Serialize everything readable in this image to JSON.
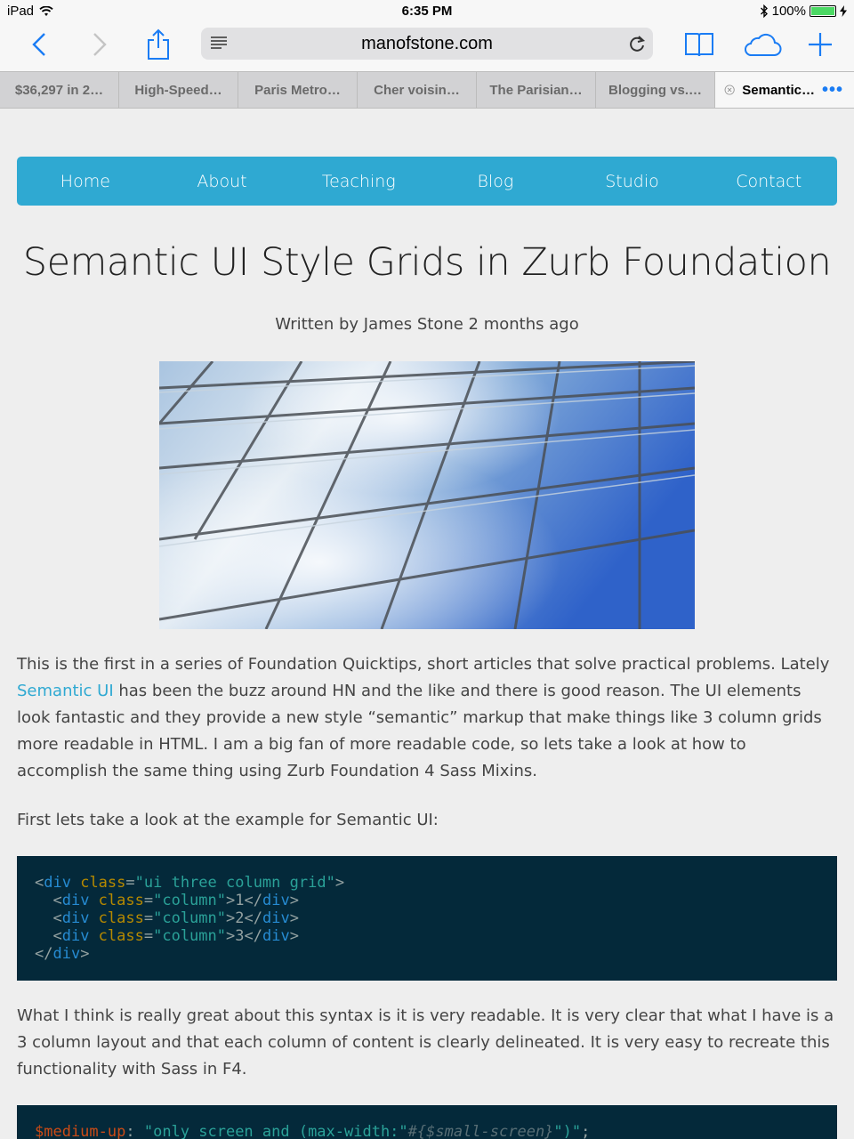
{
  "status_bar": {
    "device": "iPad",
    "time": "6:35 PM",
    "battery": "100%",
    "battery_level": 1.0
  },
  "browser": {
    "url": "manofstone.com",
    "tabs": [
      {
        "label": "$36,297 in 2…"
      },
      {
        "label": "High-Speed…"
      },
      {
        "label": "Paris Metro…"
      },
      {
        "label": "Cher voisin…"
      },
      {
        "label": "The Parisian…"
      },
      {
        "label": "Blogging vs.…"
      },
      {
        "label": "Semantic…",
        "active": true
      }
    ],
    "more": "•••"
  },
  "nav": {
    "items": [
      {
        "label": "Home"
      },
      {
        "label": "About"
      },
      {
        "label": "Teaching"
      },
      {
        "label": "Blog"
      },
      {
        "label": "Studio"
      },
      {
        "label": "Contact"
      }
    ]
  },
  "article": {
    "title": "Semantic UI Style Grids in Zurb Foundation",
    "byline": "Written by James Stone 2 months ago",
    "p1_before": "This is the first in a series of Foundation Quicktips, short articles that solve practical problems. Lately ",
    "p1_link": "Semantic UI",
    "p1_after": " has been the buzz around HN and the like and there is good reason. The UI elements look fantastic and they provide a new style “semantic” markup that make things like 3 column grids more readable in HTML. I am a big fan of more readable code, so lets take a look at how to accomplish the same thing using Zurb Foundation 4 Sass Mixins.",
    "p2": "First lets take a look at the example for Semantic UI:",
    "p3": "What I think is really great about this syntax is it is very readable. It is very clear that what I have is a 3 column layout and that each column of content is clearly delineated. It is very easy to recreate this functionality with Sass in F4.",
    "code1": {
      "l1_open": "<",
      "l1_tag": "div",
      "l1_attr": " class",
      "l1_eq": "=",
      "l1_val": "\"ui three column grid\"",
      "l1_close": ">",
      "col_open": "  <",
      "col_tag": "div",
      "col_attr": " class",
      "col_eq": "=",
      "col_val": "\"column\"",
      "col_gt": ">",
      "col1": "1",
      "col2": "2",
      "col3": "3",
      "col_end_open": "</",
      "col_end_tag": "div",
      "col_end_close": ">",
      "l5_open": "</",
      "l5_tag": "div",
      "l5_close": ">"
    },
    "code2": {
      "var": "$medium-up",
      "colon": ": ",
      "str1": "\"only screen and (max-width:\"",
      "interp": "#{$small-screen}",
      "str2": "\")\"",
      "semi": ";"
    }
  },
  "colors": {
    "nav_bg": "#2fa9d2",
    "code_bg": "#04293a",
    "link": "#2fa9d2",
    "ios_blue": "#1a7cf4"
  }
}
